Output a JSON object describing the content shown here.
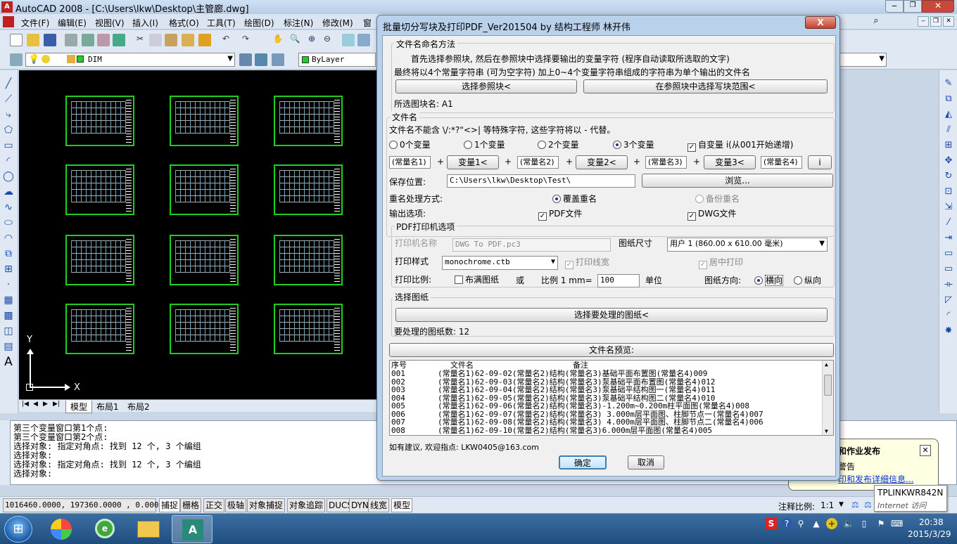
{
  "acad": {
    "title": "AutoCAD 2008 - [C:\\Users\\lkw\\Desktop\\主管廊.dwg]",
    "menus": [
      "文件(F)",
      "编辑(E)",
      "视图(V)",
      "插入(I)",
      "格式(O)",
      "工具(T)",
      "绘图(D)",
      "标注(N)",
      "修改(M)",
      "窗"
    ],
    "layer_name": "DIM",
    "color_control": "ByLayer",
    "layout_tabs": [
      "模型",
      "布局1",
      "布局2"
    ],
    "axis_y": "Y",
    "axis_x": "X",
    "command_lines": [
      "第三个变量窗口第1个点:",
      "第三个变量窗口第2个点:",
      "选择对象: 指定对角点: 找到 12 个, 3 个编组",
      "选择对象:",
      "选择对象: 指定对角点: 找到 12 个, 3 个编组",
      "选择对象:"
    ],
    "coords": "1016460.0000, 197360.0000 , 0.0000",
    "status_buttons": [
      "捕捉",
      "栅格",
      "正交",
      "极轴",
      "对象捕捉",
      "对象追踪",
      "DUCS",
      "DYN",
      "线宽",
      "模型"
    ],
    "anno_scale_label": "注释比例:",
    "anno_scale_value": "1:1",
    "notify_title": "和作业发布",
    "notify_line1": "警告",
    "notify_link": "印和发布详细信息..."
  },
  "dialog": {
    "title": "批量切分写块及打印PDF_Ver201504 by 结构工程师 林开伟",
    "close_label": "X",
    "naming_group": "文件名命名方法",
    "naming_line1": "首先选择参照块, 然后在参照块中选择要输出的变量字符 (程序自动读取所选取的文字)",
    "naming_line2": "最终将以4个常量字符串 (可为空字符) 加上0~4个变量字符串组成的字符串为单个输出的文件名",
    "btn_select_ref": "选择参照块<",
    "btn_select_range": "在参照块中选择写块范围<",
    "selected_block_label": "所选图块名: A1",
    "filename_group": "文件名",
    "filename_warning": "文件名不能含 \\/:*?\"<>| 等特殊字符, 这些字符将以 - 代替。",
    "var_options": [
      "0个变量",
      "1个变量",
      "2个变量",
      "3个变量"
    ],
    "var_selected": "3个变量",
    "autovar_label": "自变量 i(从001开始递增)",
    "const1": "(常量名1)",
    "var1_btn": "变量1<",
    "const2": "(常量名2)",
    "var2_btn": "变量2<",
    "const3": "(常量名3)",
    "var3_btn": "变量3<",
    "const4": "(常量名4)",
    "i_btn": "i",
    "plus": "+",
    "save_label": "保存位置:",
    "save_path": "C:\\Users\\lkw\\Desktop\\Test\\",
    "browse_btn": "浏览...",
    "dup_label": "重名处理方式:",
    "dup_overwrite": "覆盖重名",
    "dup_backup": "备份重名",
    "output_label": "输出选项:",
    "output_pdf": "PDF文件",
    "output_dwg": "DWG文件",
    "printer_group": "PDF打印机选项",
    "printer_name_label": "打印机名称",
    "printer_name": "DWG To PDF.pc3",
    "paper_size_label": "图纸尺寸",
    "paper_size": "用户 1 (860.00 x 610.00 毫米)",
    "plot_style_label": "打印样式",
    "plot_style": "monochrome.ctb",
    "plot_lineweight": "打印线宽",
    "center_plot": "居中打印",
    "plot_scale_label": "打印比例:",
    "fit_paper": "布满图纸",
    "or_label": "或",
    "ratio_label": "比例 1 mm=",
    "ratio_value": "100",
    "unit_label": "单位",
    "orientation_label": "图纸方向:",
    "orientation_landscape": "横向",
    "orientation_portrait": "纵向",
    "select_sheets_group": "选择图纸",
    "select_sheets_btn": "选择要处理的图纸<",
    "sheet_count": "要处理的图纸数: 12",
    "preview_btn": "文件名预览:",
    "list_headers": [
      "序号",
      "文件名",
      "备注"
    ],
    "list_rows": [
      {
        "no": "001",
        "name": "(常量名1)62-09-02(常量名2)结构(常量名3)基础平面布置图(常量名4)009"
      },
      {
        "no": "002",
        "name": "(常量名1)62-09-03(常量名2)结构(常量名3)泵基础平面布置图(常量名4)012"
      },
      {
        "no": "003",
        "name": "(常量名1)62-09-04(常量名2)结构(常量名3)泵基础平结构图一(常量名4)011"
      },
      {
        "no": "004",
        "name": "(常量名1)62-09-05(常量名2)结构(常量名3)泵基础平结构图二(常量名4)010"
      },
      {
        "no": "005",
        "name": "(常量名1)62-09-06(常量名2)结构(常量名3)-1.200m~0.200m柱平面图(常量名4)008"
      },
      {
        "no": "006",
        "name": "(常量名1)62-09-07(常量名2)结构(常量名3) 3.000m层平面图、柱脚节点一(常量名4)007"
      },
      {
        "no": "007",
        "name": "(常量名1)62-09-08(常量名2)结构(常量名3) 4.000m层平面图、柱脚节点二(常量名4)006"
      },
      {
        "no": "008",
        "name": "(常量名1)62-09-10(常量名2)结构(常量名3)6.000m层平面图(常量名4)005"
      }
    ],
    "feedback": "如有建议, 欢迎指点: LKW0405@163.com",
    "ok_btn": "确定",
    "cancel_btn": "取消"
  },
  "taskbar": {
    "network_name": "TPLINKWR842N",
    "network_status": "Internet 访问",
    "time": "20:38",
    "date": "2015/3/29"
  }
}
